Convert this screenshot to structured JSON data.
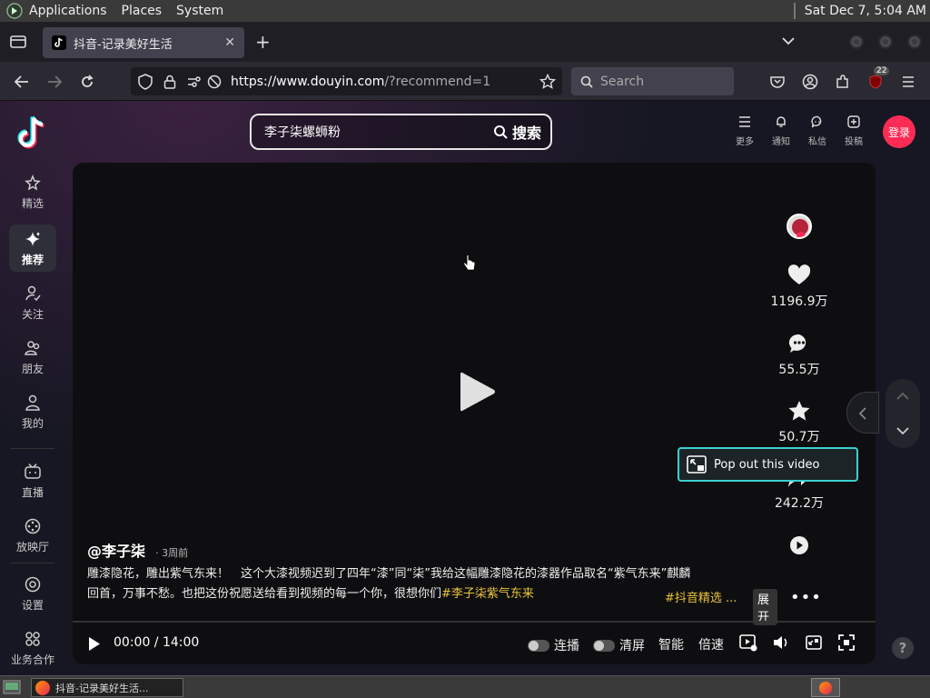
{
  "gnome_panel": {
    "menus": [
      "Applications",
      "Places",
      "System"
    ],
    "clock": "Sat Dec  7,  5:04 AM"
  },
  "browser": {
    "tab_title": "抖音-记录美好生活",
    "url_host": "https://www.douyin.com",
    "url_rest": "/?recommend=1",
    "search_placeholder": "Search",
    "extension_badge": "22"
  },
  "douyin": {
    "search_query": "李子柒螺蛳粉",
    "search_button": "搜索",
    "top_actions": [
      "更多",
      "通知",
      "私信",
      "投稿"
    ],
    "login": "登录",
    "sidebar": [
      {
        "label": "精选",
        "icon": "featured-icon"
      },
      {
        "label": "推荐",
        "icon": "sparkle-icon"
      },
      {
        "label": "关注",
        "icon": "follow-icon"
      },
      {
        "label": "朋友",
        "icon": "friends-icon"
      },
      {
        "label": "我的",
        "icon": "profile-icon"
      },
      {
        "label": "直播",
        "icon": "tv-icon"
      },
      {
        "label": "放映厅",
        "icon": "cinema-icon"
      },
      {
        "label": "设置",
        "icon": "gear-icon"
      },
      {
        "label": "业务合作",
        "icon": "grid-icon"
      }
    ],
    "video": {
      "likes": "1196.9万",
      "comments": "55.5万",
      "favorites": "50.7万",
      "shares": "242.2万",
      "popout": "Pop out this video",
      "author": "@李子柒",
      "posted": "3周前",
      "desc_line1": "雕漆隐花，雕出紫气东来！　这个大漆视频迟到了四年“漆”同“柒”我给这幅雕漆隐花的漆器作品取名“紫气东来”麒麟",
      "desc_line2": "回首，万事不愁。也把这份祝愿送给看到视频的每一个你，很想你们",
      "tag1": "#李子柒紫气东来",
      "tag2": "#抖音精选 ...",
      "expand": "展开",
      "time": "00:00 / 14:00",
      "toggle1": "连播",
      "toggle2": "清屏",
      "smart": "智能",
      "speed": "倍速"
    }
  },
  "taskbar": {
    "task_title": "抖音-记录美好生活..."
  }
}
